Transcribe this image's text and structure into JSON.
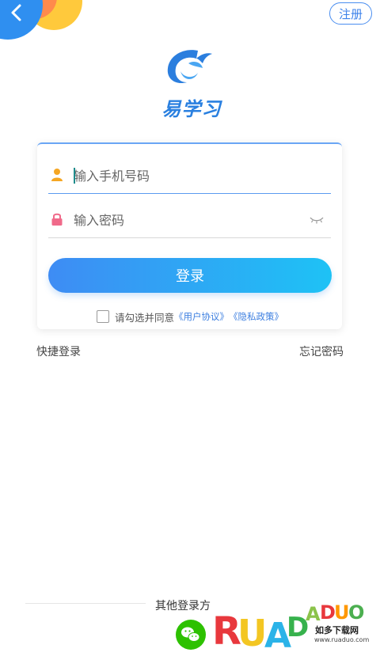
{
  "header": {
    "register_label": "注册"
  },
  "brand": {
    "name": "易学习"
  },
  "login_form": {
    "phone_placeholder": "输入手机号码",
    "password_placeholder": "输入密码",
    "login_label": "登录",
    "agreement_prefix": "请勾选并同意",
    "user_agreement": "《用户协议》",
    "privacy_policy": "《隐私政策》"
  },
  "links": {
    "quick_login": "快捷登录",
    "forgot_password": "忘记密码"
  },
  "other_login": {
    "title": "其他登录方"
  },
  "watermark": {
    "text": "RUANDAOO",
    "subtitle": "如多下载网",
    "url": "www.ruaduo.com"
  },
  "colors": {
    "accent": "#3d82ea",
    "gradient_start": "#3e8cf4",
    "gradient_end": "#1ec2f5",
    "wechat": "#2dc100"
  }
}
